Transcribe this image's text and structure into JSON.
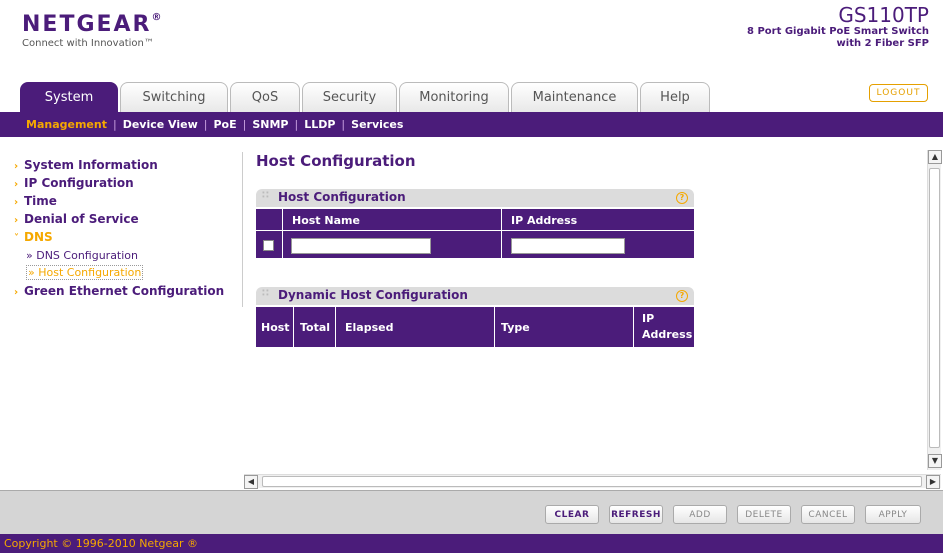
{
  "header": {
    "brand": "NETGEAR",
    "registered": "®",
    "tagline": "Connect with Innovation™",
    "model": "GS110TP",
    "model_desc_line1": "8 Port Gigabit PoE Smart Switch",
    "model_desc_line2": "with 2 Fiber SFP"
  },
  "tabs": [
    {
      "label": "System",
      "active": true
    },
    {
      "label": "Switching"
    },
    {
      "label": "QoS"
    },
    {
      "label": "Security"
    },
    {
      "label": "Monitoring"
    },
    {
      "label": "Maintenance"
    },
    {
      "label": "Help"
    }
  ],
  "logout_label": "LOGOUT",
  "subnav": [
    {
      "label": "Management",
      "active": true
    },
    {
      "label": "Device View"
    },
    {
      "label": "PoE"
    },
    {
      "label": "SNMP"
    },
    {
      "label": "LLDP"
    },
    {
      "label": "Services"
    }
  ],
  "subnav_sep": "|",
  "sidebar": {
    "items": [
      {
        "label": "System Information"
      },
      {
        "label": "IP Configuration"
      },
      {
        "label": "Time"
      },
      {
        "label": "Denial of Service"
      },
      {
        "label": "DNS",
        "expanded": true
      },
      {
        "label": "Green Ethernet Configuration"
      }
    ],
    "sub_items": [
      {
        "label": "» DNS Configuration"
      },
      {
        "label": "» Host Configuration",
        "active": true
      }
    ]
  },
  "page_title": "Host Configuration",
  "host_config": {
    "title": "Host Configuration",
    "help": "?",
    "col_host_name": "Host Name",
    "col_ip_address": "IP Address",
    "host_name_value": "",
    "ip_address_value": ""
  },
  "dynamic_host_config": {
    "title": "Dynamic Host Configuration",
    "help": "?",
    "columns": [
      "Host",
      "Total",
      "Elapsed",
      "Type",
      "IP",
      "Address"
    ]
  },
  "buttons": {
    "clear": "CLEAR",
    "refresh": "REFRESH",
    "add": "ADD",
    "delete": "DELETE",
    "cancel": "CANCEL",
    "apply": "APPLY"
  },
  "copyright": "Copyright © 1996-2010 Netgear ®",
  "colors": {
    "brand_purple": "#4b1c7a",
    "accent_orange": "#f5a800"
  }
}
